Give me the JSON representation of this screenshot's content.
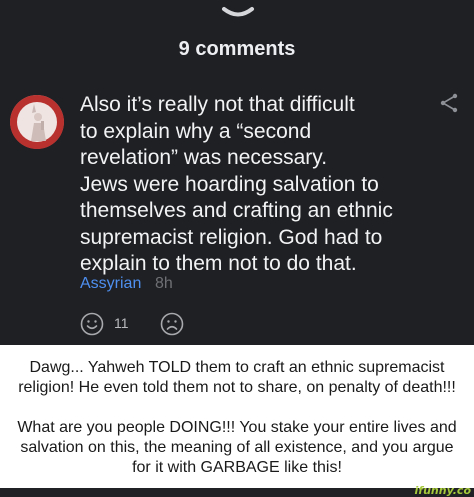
{
  "header": {
    "comments_title": "9 comments"
  },
  "comment": {
    "avatar_icon": "avatar-statue-of-liberty",
    "lines": [
      "Also it’s really not that difficult",
      "to explain why a “second",
      "revelation” was necessary.",
      "Jews were hoarding salvation to",
      "themselves and crafting an ethnic",
      "supremacist religion. God had to",
      "explain to them not to do that."
    ],
    "username": "Assyrian",
    "time": "8h",
    "smile_count": "11",
    "colors": {
      "username": "#4e8ff0",
      "background": "#1f2023",
      "text": "#f2f3f5"
    }
  },
  "reply": {
    "paragraph1": "Dawg... Yahweh TOLD them to craft an ethnic supremacist religion! He even told them not to share, on penalty of death!!!",
    "paragraph2": "What are you people DOING!!! You stake your entire lives and salvation on this, the meaning of all existence, and you argue for it with GARBAGE like this!"
  },
  "watermark": {
    "text": "ifunny.co",
    "color": "#a5c93b"
  }
}
